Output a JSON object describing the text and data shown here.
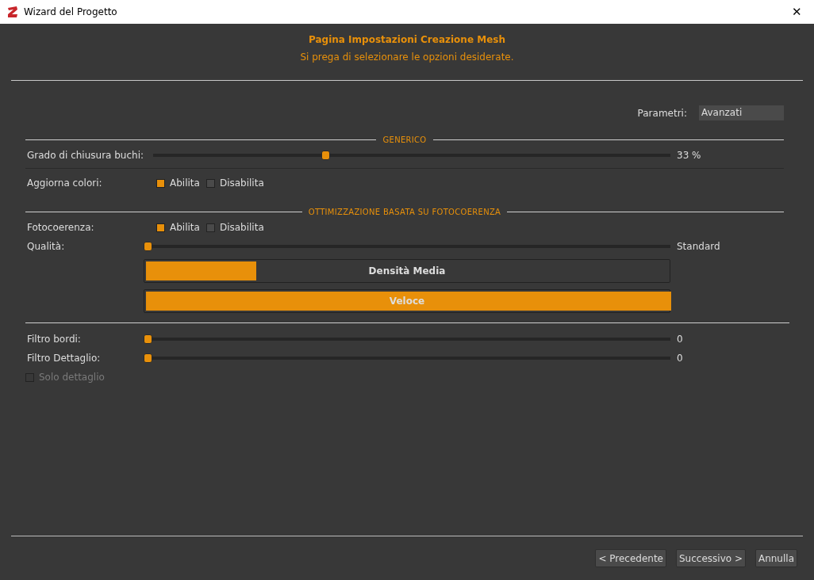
{
  "window": {
    "title": "Wizard del Progetto",
    "close": "✕"
  },
  "header": {
    "title": "Pagina Impostazioni Creazione Mesh",
    "subtitle": "Si prega di selezionare le opzioni desiderate."
  },
  "parameters": {
    "label": "Parametri:",
    "value": "Avanzati"
  },
  "sections": [
    {
      "title": "GENERICO",
      "rows": [
        {
          "kind": "slider",
          "label": "Grado di chiusura buchi:",
          "level": 0.33,
          "reading": "33 %"
        },
        {
          "kind": "separator"
        },
        {
          "kind": "choice",
          "label": "Aggiorna colori:",
          "options": [
            {
              "label": "Abilita",
              "selected": true
            },
            {
              "label": "Disabilita",
              "selected": false
            }
          ]
        }
      ]
    },
    {
      "title": "OTTIMIZZAZIONE BASATA SU FOTOCOERENZA",
      "rows": [
        {
          "kind": "choice",
          "label": "Fotocoerenza:",
          "options": [
            {
              "label": "Abilita",
              "selected": true
            },
            {
              "label": "Disabilita",
              "selected": false
            }
          ]
        },
        {
          "kind": "slider",
          "label": "Qualità:",
          "level": 0,
          "reading": "Standard"
        },
        {
          "kind": "bar",
          "text": "Densità Media",
          "level": 0.21
        },
        {
          "kind": "bar",
          "text": "Veloce",
          "level": 1
        }
      ]
    },
    {
      "rows": [
        {
          "kind": "slider",
          "label": "Filtro bordi:",
          "level": 0,
          "reading": "0"
        },
        {
          "kind": "slider",
          "label": "Filtro Dettaglio:",
          "level": 0,
          "reading": "0"
        },
        {
          "kind": "checkbox",
          "label": "Solo dettaglio",
          "checked": false,
          "disabled": true
        }
      ]
    }
  ],
  "buttons": [
    "< Precedente",
    "Successivo >",
    "Annulla"
  ]
}
